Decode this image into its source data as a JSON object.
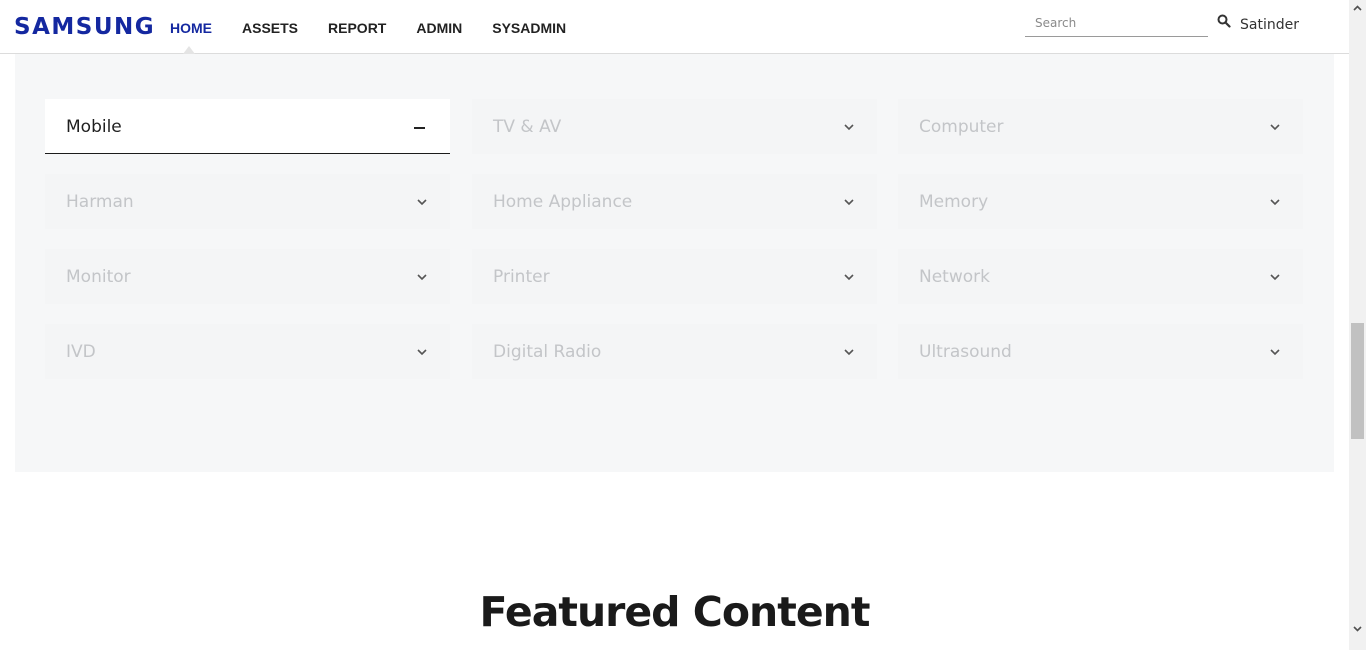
{
  "header": {
    "logo": "SAMSUNG",
    "nav": [
      {
        "label": "HOME",
        "active": true
      },
      {
        "label": "ASSETS"
      },
      {
        "label": "REPORT"
      },
      {
        "label": "ADMIN"
      },
      {
        "label": "SYSADMIN"
      }
    ],
    "search": {
      "placeholder": "Search",
      "value": ""
    },
    "search_icon": "search-icon",
    "user": "Satinder"
  },
  "categories": [
    {
      "label": "Mobile",
      "expanded": true,
      "icon": "minus-icon"
    },
    {
      "label": "TV & AV",
      "icon": "chevron-down-icon"
    },
    {
      "label": "Computer",
      "icon": "chevron-down-icon"
    },
    {
      "label": "Harman",
      "icon": "chevron-down-icon"
    },
    {
      "label": "Home Appliance",
      "icon": "chevron-down-icon"
    },
    {
      "label": "Memory",
      "icon": "chevron-down-icon"
    },
    {
      "label": "Monitor",
      "icon": "chevron-down-icon"
    },
    {
      "label": "Printer",
      "icon": "chevron-down-icon"
    },
    {
      "label": "Network",
      "icon": "chevron-down-icon"
    },
    {
      "label": "IVD",
      "icon": "chevron-down-icon"
    },
    {
      "label": "Digital Radio",
      "icon": "chevron-down-icon"
    },
    {
      "label": "Ultrasound",
      "icon": "chevron-down-icon"
    }
  ],
  "featured": {
    "title": "Featured Content"
  },
  "colors": {
    "brand": "#1428a0",
    "panel_bg": "#f6f7f8",
    "inactive_text": "#c3c5c8"
  }
}
